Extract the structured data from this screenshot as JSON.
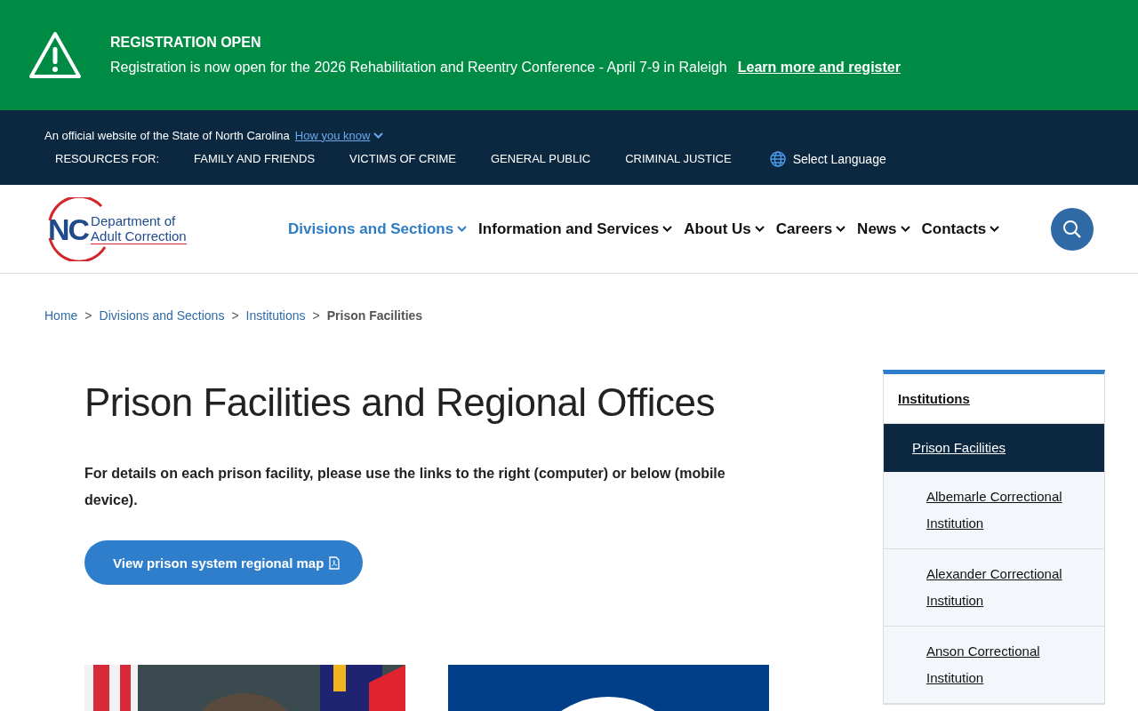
{
  "alert": {
    "title": "REGISTRATION OPEN",
    "message": "Registration is now open for the 2026 Rehabilitation and Reentry Conference - April 7-9 in Raleigh",
    "link": "Learn more and register"
  },
  "official_bar": {
    "text": "An official website of the State of North Carolina",
    "link": "How you know",
    "resources_label": "RESOURCES FOR:",
    "resources": [
      "FAMILY AND FRIENDS",
      "VICTIMS OF CRIME",
      "GENERAL PUBLIC",
      "CRIMINAL JUSTICE"
    ],
    "language": "Select Language"
  },
  "logo": {
    "initials": "NC",
    "line_1": "Department of",
    "line_2": "Adult Correction"
  },
  "main_nav": [
    {
      "label": "Divisions and Sections",
      "selected": true
    },
    {
      "label": "Information and Services",
      "selected": false
    },
    {
      "label": "About Us",
      "selected": false
    },
    {
      "label": "Careers",
      "selected": false
    },
    {
      "label": "News",
      "selected": false
    },
    {
      "label": "Contacts",
      "selected": false
    }
  ],
  "breadcrumb": [
    {
      "label": "Home",
      "current": false
    },
    {
      "separator": ">",
      "label": "Divisions and Sections",
      "current": false
    },
    {
      "separator": ">",
      "label": "Institutions",
      "current": false
    },
    {
      "separator": ">",
      "label": "Prison Facilities",
      "current": true
    }
  ],
  "page": {
    "title": "Prison Facilities and Regional Offices",
    "intro": "For details on each prison facility, please use the links to the right (computer) or below (mobile device).",
    "button": "View prison system regional map"
  },
  "side_nav": {
    "title": "Institutions",
    "items": [
      {
        "label": "Prison Facilities",
        "selected": true,
        "children": [
          {
            "label": "Albemarle Correctional Institution",
            "selected": false
          },
          {
            "label": "Alexander Correctional Institution",
            "selected": false
          },
          {
            "label": "Anson Correctional Institution",
            "selected": false
          }
        ]
      }
    ]
  }
}
